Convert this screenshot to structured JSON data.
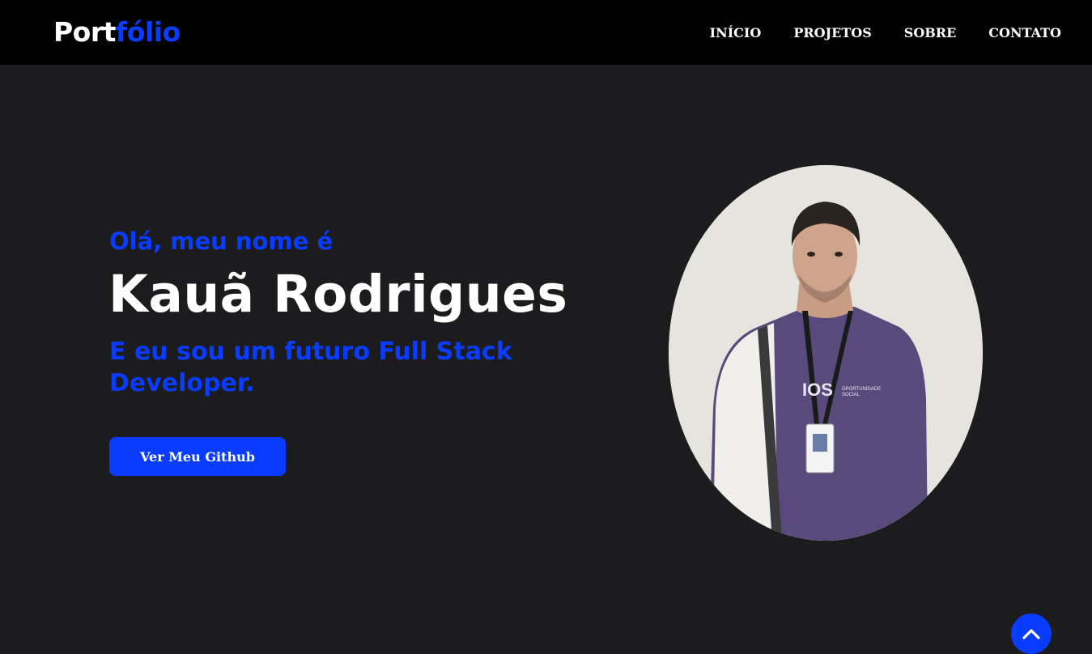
{
  "logo": {
    "part1": "Port",
    "part2": "fólio"
  },
  "nav": {
    "items": [
      {
        "label": "INÍCIO"
      },
      {
        "label": "PROJETOS"
      },
      {
        "label": "SOBRE"
      },
      {
        "label": "CONTATO"
      }
    ]
  },
  "hero": {
    "greeting": "Olá, meu nome é",
    "name": "Kauã Rodrigues",
    "role": "E eu sou um futuro Full Stack Developer.",
    "button_label": "Ver Meu Github"
  },
  "colors": {
    "accent": "#0a3cff",
    "background": "#1c1b1d",
    "navbar": "#000000",
    "text": "#ffffff"
  },
  "icons": {
    "scroll_top": "chevron-up-icon"
  }
}
